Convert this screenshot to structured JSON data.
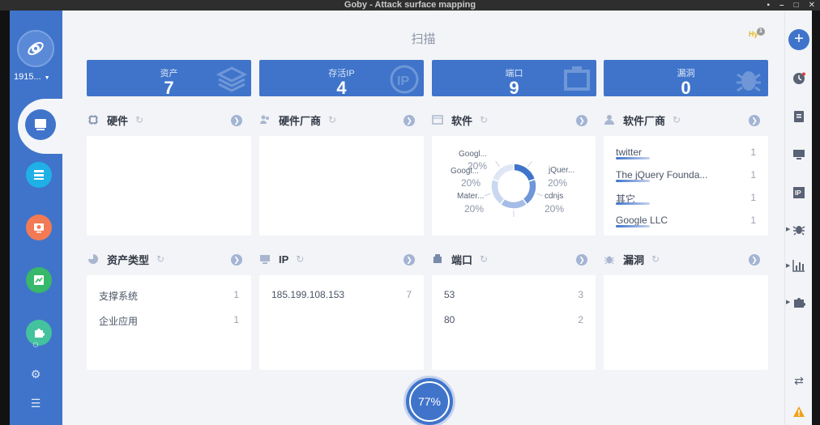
{
  "window": {
    "title": "Goby - Attack surface mapping",
    "controls": [
      "▪",
      "–",
      "□",
      "✕"
    ]
  },
  "user": {
    "name": "1915..."
  },
  "page": {
    "title": "扫描",
    "badge_text": "Hy",
    "badge_count": "1"
  },
  "stats": [
    {
      "label": "资产",
      "value": "7"
    },
    {
      "label": "存活IP",
      "value": "4"
    },
    {
      "label": "端口",
      "value": "9"
    },
    {
      "label": "漏洞",
      "value": "0"
    }
  ],
  "sections": {
    "hardware": {
      "title": "硬件"
    },
    "hardware_vendor": {
      "title": "硬件厂商"
    },
    "software": {
      "title": "软件"
    },
    "software_vendor": {
      "title": "软件厂商",
      "rows": [
        {
          "label": "twitter",
          "value": "1"
        },
        {
          "label": "The jQuery Founda...",
          "value": "1"
        },
        {
          "label": "其它",
          "value": "1"
        },
        {
          "label": "Google LLC",
          "value": "1"
        }
      ]
    },
    "asset_type": {
      "title": "资产类型",
      "rows": [
        {
          "label": "支撑系统",
          "value": "1"
        },
        {
          "label": "企业应用",
          "value": "1"
        }
      ]
    },
    "ip": {
      "title": "IP",
      "rows": [
        {
          "label": "185.199.108.153",
          "value": "7"
        }
      ]
    },
    "port": {
      "title": "端口",
      "rows": [
        {
          "label": "53",
          "value": "3"
        },
        {
          "label": "80",
          "value": "2"
        }
      ]
    },
    "vuln": {
      "title": "漏洞"
    }
  },
  "chart_data": {
    "type": "pie",
    "categories": [
      "Googl...",
      "Googl...",
      "Mater...",
      "jQuer...",
      "cdnjs"
    ],
    "values": [
      20,
      20,
      20,
      20,
      20
    ],
    "labels": [
      "20%",
      "20%",
      "20%",
      "20%",
      "20%"
    ],
    "colors": [
      "#3f74ca",
      "#6f96d8",
      "#a5bde6",
      "#c9d7f0",
      "#dfe7f5"
    ]
  },
  "progress": {
    "value": 77,
    "label": "77%"
  }
}
